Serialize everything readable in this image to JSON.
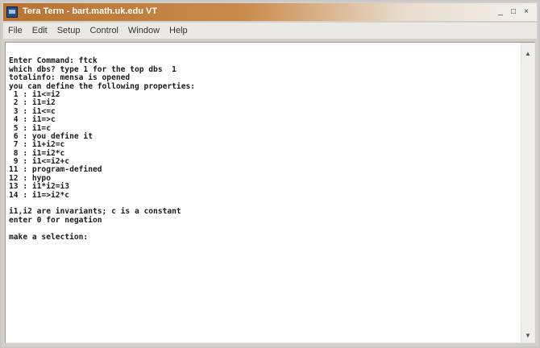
{
  "window": {
    "title": "Tera Term - bart.math.uk.edu VT",
    "minimize_glyph": "_",
    "maximize_glyph": "□",
    "close_glyph": "×"
  },
  "menu": {
    "items": [
      {
        "label": "File"
      },
      {
        "label": "Edit"
      },
      {
        "label": "Setup"
      },
      {
        "label": "Control"
      },
      {
        "label": "Window"
      },
      {
        "label": "Help"
      }
    ]
  },
  "terminal": {
    "lines": [
      "",
      "Enter Command: ftck",
      "which dbs? type 1 for the top dbs  1",
      "totalinfo: mensa is opened",
      "you can define the following properties:",
      " 1 : i1<=i2",
      " 2 : i1=i2",
      " 3 : i1<=c",
      " 4 : i1=>c",
      " 5 : i1=c",
      " 6 : you define it",
      " 7 : i1+i2=c",
      " 8 : i1=i2*c",
      " 9 : i1<=i2+c",
      "11 : program-defined",
      "12 : hypo",
      "13 : i1*i2=i3",
      "14 : i1=>i2*c",
      "",
      "i1,i2 are invariants; c is a constant",
      "enter 0 for negation",
      "",
      "make a selection:"
    ]
  },
  "scrollbar": {
    "up_glyph": "▲",
    "down_glyph": "▼"
  }
}
